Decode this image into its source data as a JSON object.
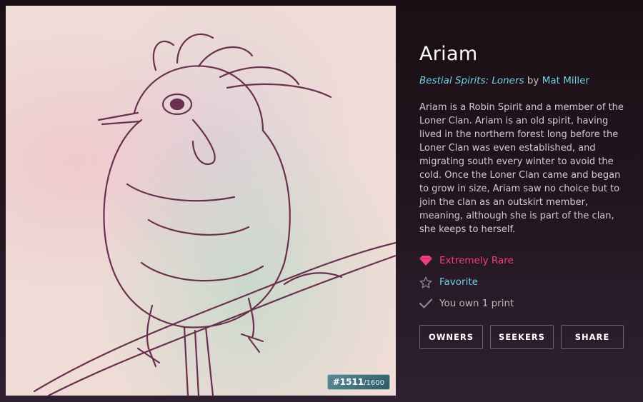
{
  "artwork": {
    "alt": "Ariam artwork",
    "print_number": "#1511",
    "print_separator": "/",
    "print_total": "1600"
  },
  "card": {
    "title": "Ariam",
    "series": "Bestial Spirits: Loners",
    "by": " by ",
    "artist": "Mat Miller",
    "description": "Ariam is a Robin Spirit and a member of the Loner Clan. Ariam is an old spirit, having lived in the northern forest long before the Loner Clan was even established, and migrating south every winter to avoid the cold. Once the Loner Clan came and began to grow in size, Ariam saw no choice but to join the clan as an outskirt member, meaning, although she is part of the clan, she keeps to herself."
  },
  "stats": {
    "rarity": {
      "label": "Extremely Rare",
      "icon": "gem-icon",
      "color": "#ef3f82"
    },
    "favorite": {
      "label": "Favorite",
      "icon": "star-outline-icon",
      "color": "#6fd0e6"
    },
    "owned": {
      "label": "You own 1 print",
      "icon": "checkmark-icon",
      "color": "#bfb6bd"
    }
  },
  "buttons": {
    "owners": "OWNERS",
    "seekers": "SEEKERS",
    "share": "SHARE"
  }
}
